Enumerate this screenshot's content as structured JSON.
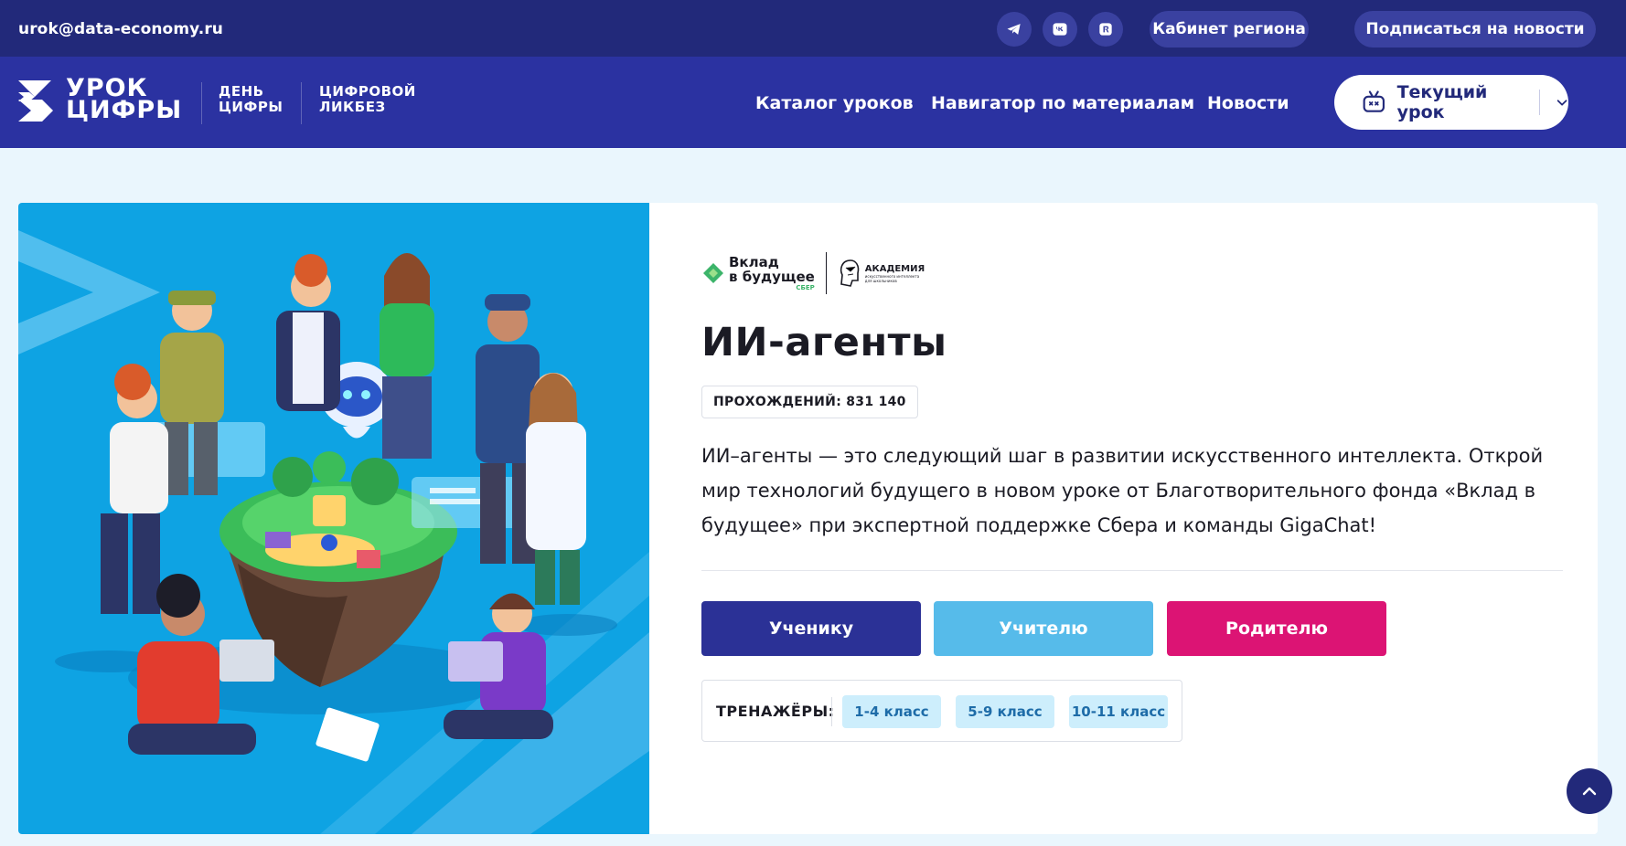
{
  "topbar": {
    "email": "urok@data-economy.ru",
    "social": [
      "telegram-icon",
      "vk-icon",
      "rutube-icon"
    ],
    "region_cabinet_label": "Кабинет региона",
    "subscribe_label": "Подписаться на новости"
  },
  "header": {
    "logo_line1": "УРОК",
    "logo_line2": "ЦИФРЫ",
    "brand_day_line1": "ДЕНЬ",
    "brand_day_line2": "ЦИФРЫ",
    "brand_likbez_line1": "ЦИФРОВОЙ",
    "brand_likbez_line2": "ЛИКБЕЗ",
    "nav": [
      "Каталог уроков",
      "Навигатор по материалам",
      "Новости"
    ],
    "current_lesson_label": "Текущий урок"
  },
  "lesson": {
    "partners": {
      "vklad_line1": "Вклад",
      "vklad_line2": "в будущее",
      "vklad_sub": "СБЕР",
      "academy": "АКАДЕМИЯ",
      "academy_sub": "искусственного интеллекта для школьников"
    },
    "title": "ИИ-агенты",
    "completions_label": "ПРОХОЖДЕНИЙ: 831 140",
    "description": "ИИ–агенты — это следующий шаг в развитии искусственного интеллекта. Открой мир технологий будущего в новом уроке от Благотворительного фонда «Вклад в будущее» при экспертной поддержке Сбера и команды GigaChat!",
    "roles": [
      "Ученику",
      "Учителю",
      "Родителю"
    ],
    "trainers_label": "ТРЕНАЖЁРЫ:",
    "grades": [
      "1-4 класс",
      "5-9 класс",
      "10-11 класс"
    ]
  },
  "colors": {
    "topbar": "#22297a",
    "navbar": "#2b32a1",
    "student": "#2b3196",
    "teacher": "#56bbea",
    "parent": "#dc1474",
    "illustration_bg": "#0ea3e3"
  }
}
